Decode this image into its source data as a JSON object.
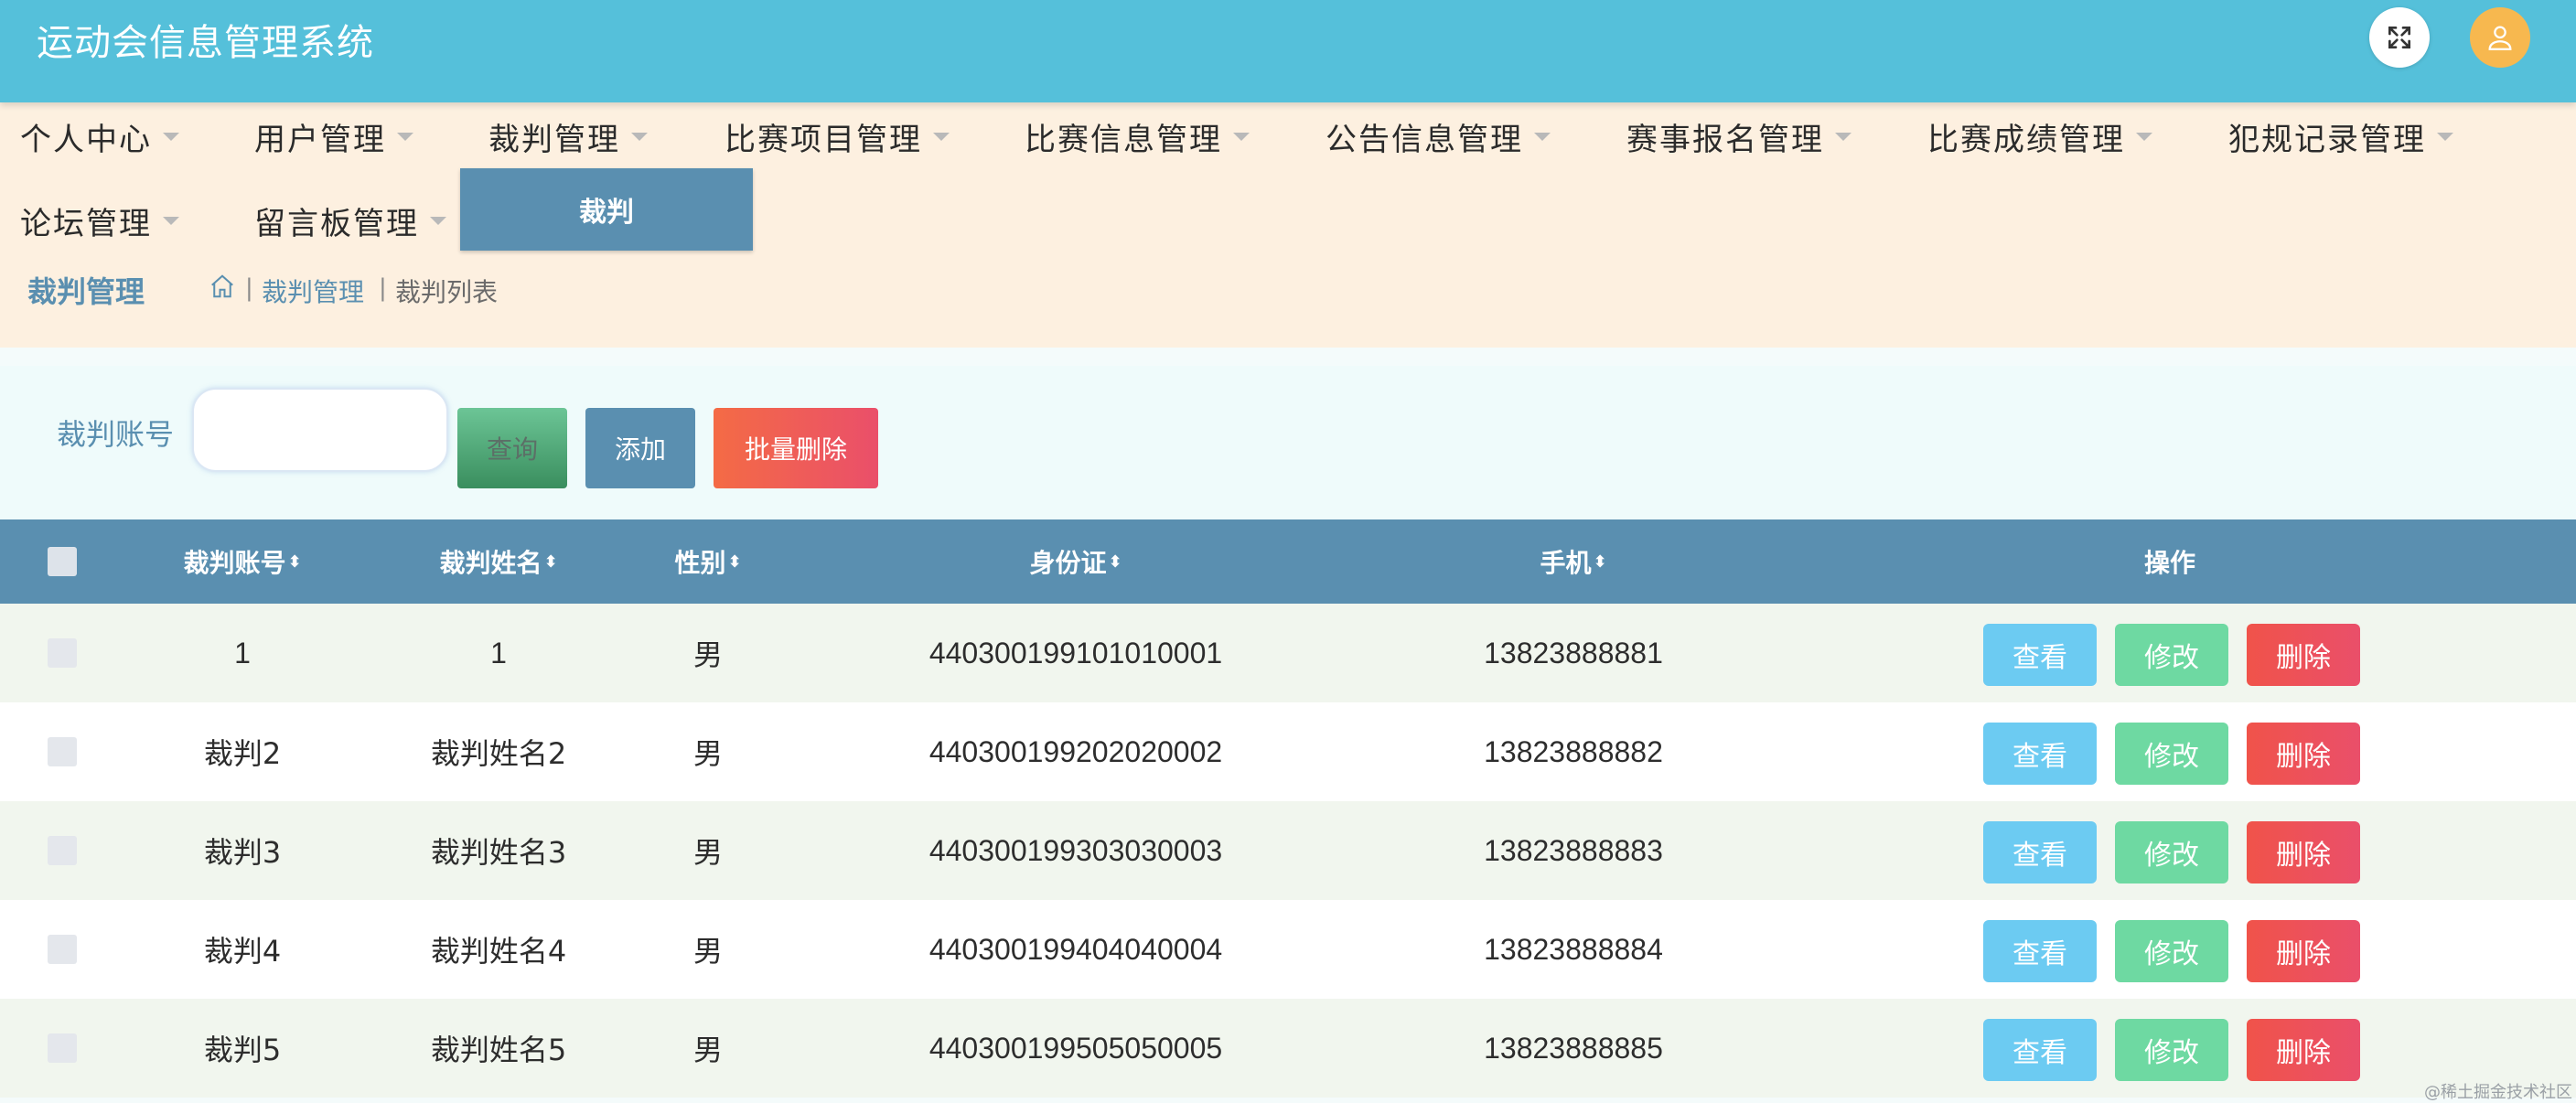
{
  "header": {
    "title": "运动会信息管理系统",
    "fullscreen_icon": "fullscreen-icon",
    "user_icon": "user-icon"
  },
  "nav": {
    "items": [
      {
        "label": "个人中心"
      },
      {
        "label": "用户管理"
      },
      {
        "label": "裁判管理"
      },
      {
        "label": "比赛项目管理"
      },
      {
        "label": "比赛信息管理"
      },
      {
        "label": "公告信息管理"
      },
      {
        "label": "赛事报名管理"
      },
      {
        "label": "比赛成绩管理"
      },
      {
        "label": "犯规记录管理"
      },
      {
        "label": "论坛管理"
      },
      {
        "label": "留言板管理"
      }
    ],
    "active_submenu": "裁判"
  },
  "breadcrumb": {
    "title": "裁判管理",
    "separator": "|",
    "link": "裁判管理",
    "current": "裁判列表"
  },
  "search": {
    "label": "裁判账号",
    "value": "",
    "query_label": "查询",
    "add_label": "添加",
    "batch_delete_label": "批量删除"
  },
  "table": {
    "columns": [
      "裁判账号",
      "裁判姓名",
      "性别",
      "身份证",
      "手机",
      "操作"
    ],
    "sort_glyph": "⬍",
    "actions": {
      "view": "查看",
      "edit": "修改",
      "delete": "删除"
    },
    "rows": [
      {
        "account": "1",
        "name": "1",
        "gender": "男",
        "id_card": "440300199101010001",
        "phone": "13823888881"
      },
      {
        "account": "裁判2",
        "name": "裁判姓名2",
        "gender": "男",
        "id_card": "440300199202020002",
        "phone": "13823888882"
      },
      {
        "account": "裁判3",
        "name": "裁判姓名3",
        "gender": "男",
        "id_card": "440300199303030003",
        "phone": "13823888883"
      },
      {
        "account": "裁判4",
        "name": "裁判姓名4",
        "gender": "男",
        "id_card": "440300199404040004",
        "phone": "13823888884"
      },
      {
        "account": "裁判5",
        "name": "裁判姓名5",
        "gender": "男",
        "id_card": "440300199505050005",
        "phone": "13823888885"
      }
    ]
  },
  "watermark": "@稀土掘金技术社区",
  "colors": {
    "header": "#55c0da",
    "nav_bg": "#fdf0e0",
    "primary": "#5a8fb0",
    "view": "#6ccbf2",
    "edit": "#6ed9a2",
    "delete": "#f0534a"
  }
}
